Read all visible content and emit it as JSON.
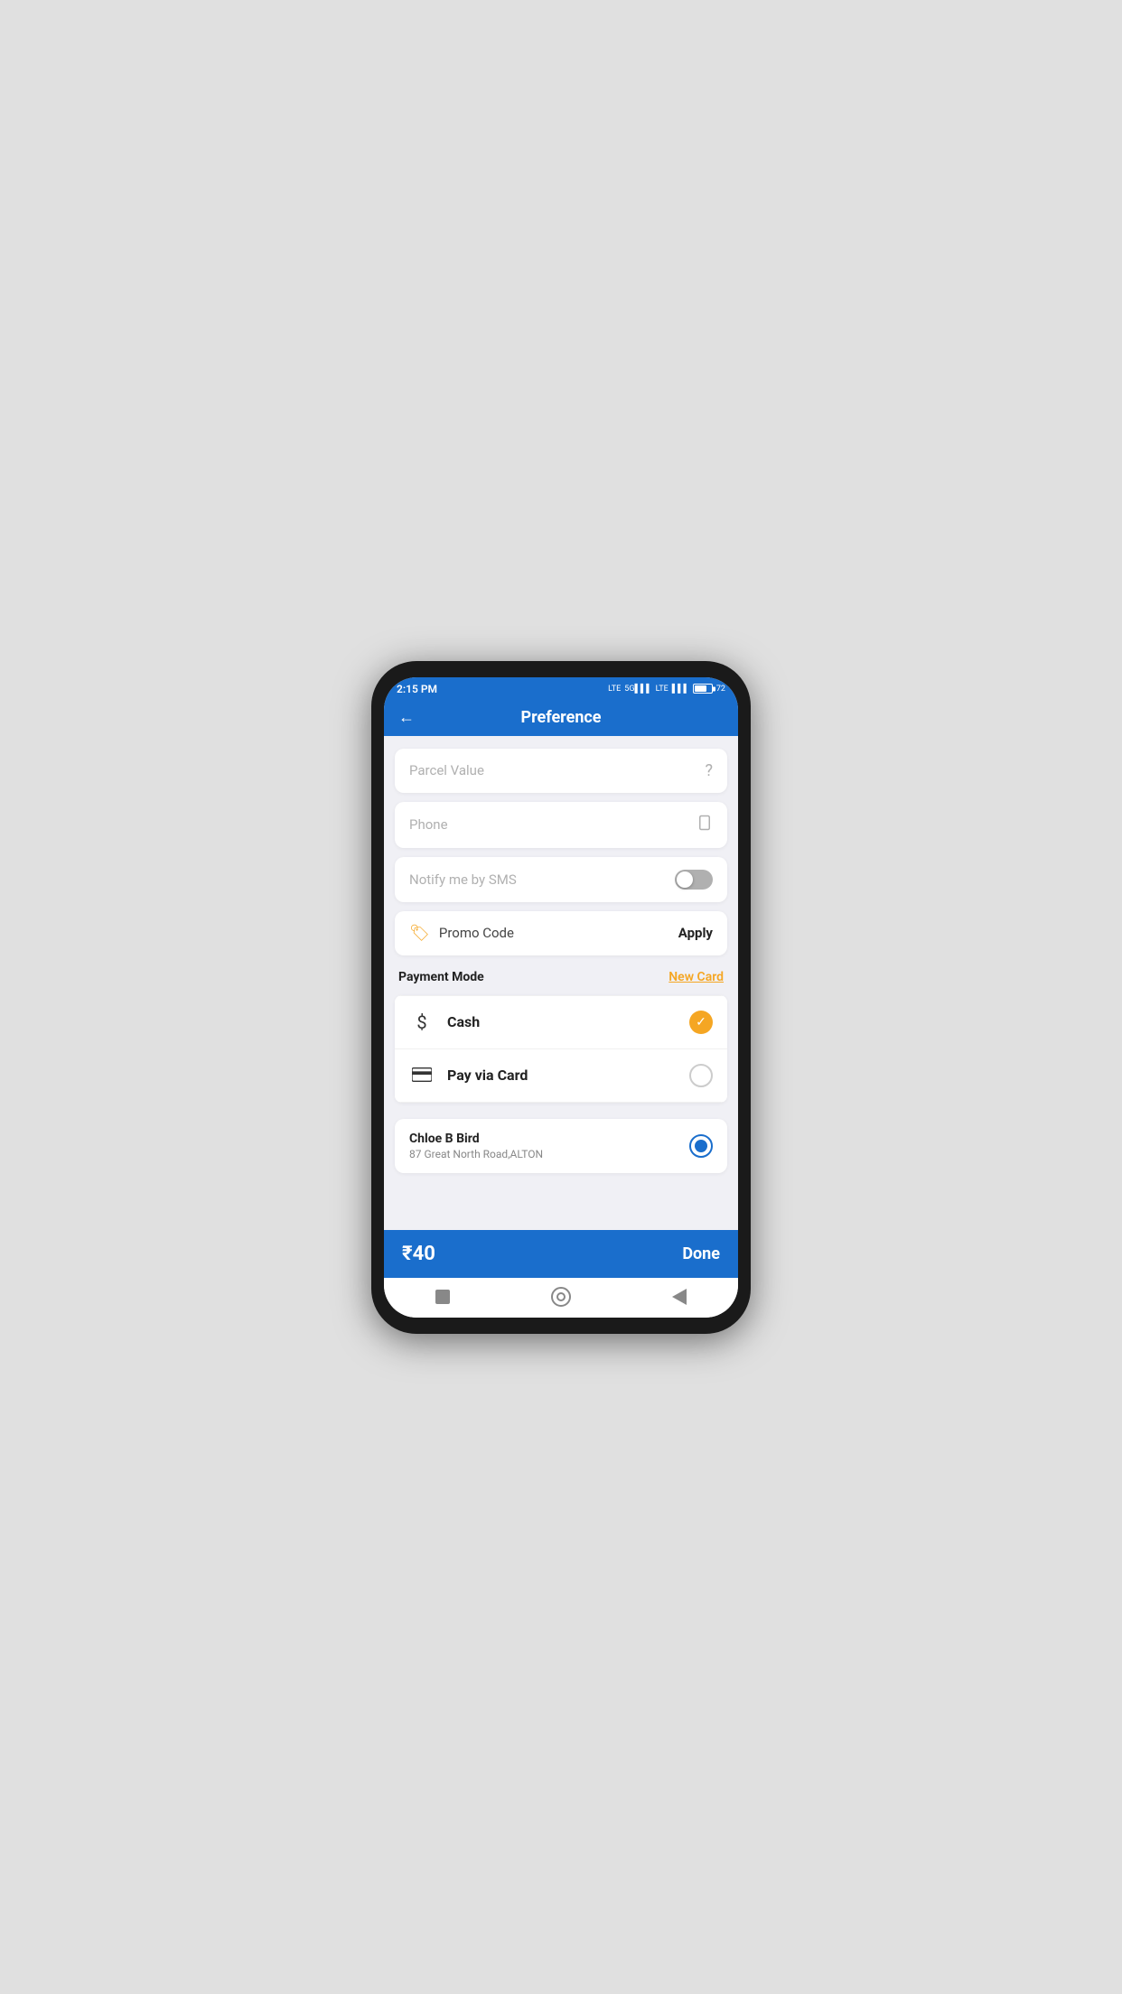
{
  "statusBar": {
    "time": "2:15 PM",
    "battery": "72"
  },
  "header": {
    "title": "Preference",
    "backLabel": "←"
  },
  "fields": {
    "parcelValuePlaceholder": "Parcel Value",
    "phonePlaceholder": "Phone",
    "notifyLabel": "Notify me by SMS"
  },
  "promoCode": {
    "label": "Promo Code",
    "applyLabel": "Apply"
  },
  "paymentMode": {
    "label": "Payment Mode",
    "newCardLabel": "New Card"
  },
  "paymentOptions": [
    {
      "label": "Cash",
      "icon": "$",
      "selected": true
    },
    {
      "label": "Pay via Card",
      "icon": "💳",
      "selected": false
    }
  ],
  "address": {
    "name": "Chloe B Bird",
    "detail": "87  Great North Road,ALTON"
  },
  "bottomBar": {
    "price": "₹40",
    "doneLabel": "Done"
  }
}
